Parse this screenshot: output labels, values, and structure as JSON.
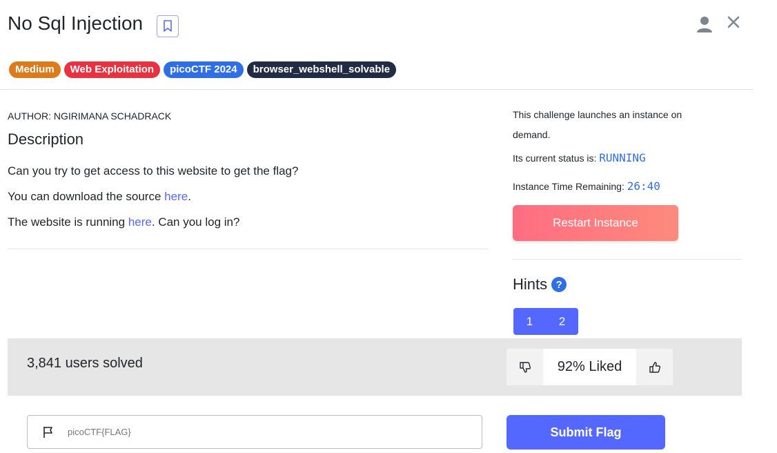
{
  "header": {
    "title": "No Sql Injection",
    "bookmark_icon": "bookmark-icon",
    "user_icon": "user-icon",
    "close_icon": "close-icon"
  },
  "tags": [
    {
      "label": "Medium",
      "color": "#dd7a1a"
    },
    {
      "label": "Web Exploitation",
      "color": "#e9313f"
    },
    {
      "label": "picoCTF 2024",
      "color": "#2e6fe8"
    },
    {
      "label": "browser_webshell_solvable",
      "color": "#222b44"
    }
  ],
  "description": {
    "author": "AUTHOR: NGIRIMANA SCHADRACK",
    "heading": "Description",
    "line1": "Can you try to get access to this website to get the flag?",
    "line2_pre": "You can download the source ",
    "line2_link": "here",
    "line2_post": ".",
    "line3_pre": "The website is running ",
    "line3_link": "here",
    "line3_post": ". Can you log in?"
  },
  "instance": {
    "launch_text": "This challenge launches an instance on demand.",
    "status_label": "Its current status is:",
    "status_value": "RUNNING",
    "time_label": "Instance Time Remaining:",
    "time_value": "26:40",
    "restart_label": "Restart Instance"
  },
  "hints": {
    "label": "Hints",
    "help_icon": "question-circle-icon",
    "items": [
      "1",
      "2"
    ]
  },
  "stats": {
    "solved": "3,841 users solved",
    "liked": "92% Liked",
    "dislike_icon": "thumbs-down-icon",
    "like_icon": "thumbs-up-icon"
  },
  "flag": {
    "placeholder": "picoCTF{FLAG}",
    "flag_icon": "flag-icon",
    "submit_label": "Submit Flag"
  },
  "colors": {
    "accent": "#5468ff",
    "restart_gradient_start": "#fe6d82",
    "restart_gradient_end": "#fd8a7c",
    "status_mono": "#2e6fe8"
  }
}
